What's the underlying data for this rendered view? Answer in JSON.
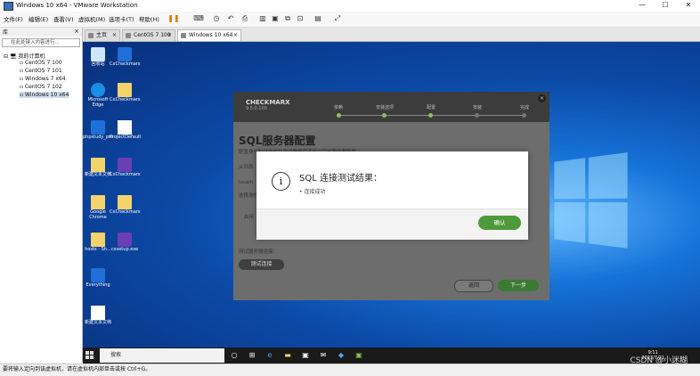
{
  "window": {
    "title": "Windows 10 x64 - VMware Workstation",
    "minimize": "—",
    "maximize": "☐",
    "close": "✕"
  },
  "menubar": {
    "items": [
      "文件(F)",
      "编辑(E)",
      "查看(V)",
      "虚拟机(M)",
      "选项卡(T)",
      "帮助(H)"
    ]
  },
  "library": {
    "header": "库",
    "close": "×",
    "search_placeholder": "在此处键入内容进行...",
    "root": "我的计算机",
    "vms": [
      "CentOS 7 100",
      "CentOS 7 101",
      "Windows 7 x64",
      "CentOS 7 102",
      "Windows 10 x64"
    ],
    "selected_vm_index": 4
  },
  "tabs": [
    {
      "label": "主页",
      "close": "×"
    },
    {
      "label": "CentOS 7 100",
      "close": "×"
    },
    {
      "label": "Windows 10 x64",
      "close": "×",
      "active": true
    }
  ],
  "desktop": {
    "icons": [
      "回收站",
      "CxCheckmarx",
      "Microsoft Edge",
      "CxCheckmarx",
      "phpstudy_pro",
      "ProjectDefault",
      "新建文本文档",
      "CxCheckmarx",
      "Google Chrome",
      "CxCheckmarx",
      "hosts - Sh...",
      "cxsetup.exe",
      "Everything",
      "",
      "新建文本文档"
    ]
  },
  "installer": {
    "logo": "CHECKMARX",
    "logo_sub": "9.5.0.100",
    "close": "×",
    "steps": [
      "依赖",
      "安装选项",
      "配置",
      "安装",
      "完成"
    ],
    "steps_done": 3,
    "title": "SQL服务器配置",
    "faint_texts": [
      "配置身份验证方式并测试数据库连接以完成服务器配置",
      "从列表",
      "localh",
      "选择身份验证方式",
      "启用",
      "测试服务器连接：",
      "启用"
    ],
    "test_button": "测试连接",
    "back_button": "返回",
    "next_button": "下一步"
  },
  "dialog": {
    "icon": "i",
    "title": "SQL 连接测试结果：",
    "message": "• 连接成功",
    "ok": "确认"
  },
  "taskbar": {
    "search": "搜索",
    "clock_time": "9:11",
    "clock_date": "2023/7/21"
  },
  "statusbar": {
    "text": "要将输入定向到该虚拟机，请在虚拟机内部单击或按 Ctrl+G。",
    "watermark": "CSDN @小迷糊"
  },
  "colors": {
    "accent_green": "#4e9a3b",
    "desktop_blue": "#0c4aa7",
    "installer_gray": "#6d6d6d"
  }
}
